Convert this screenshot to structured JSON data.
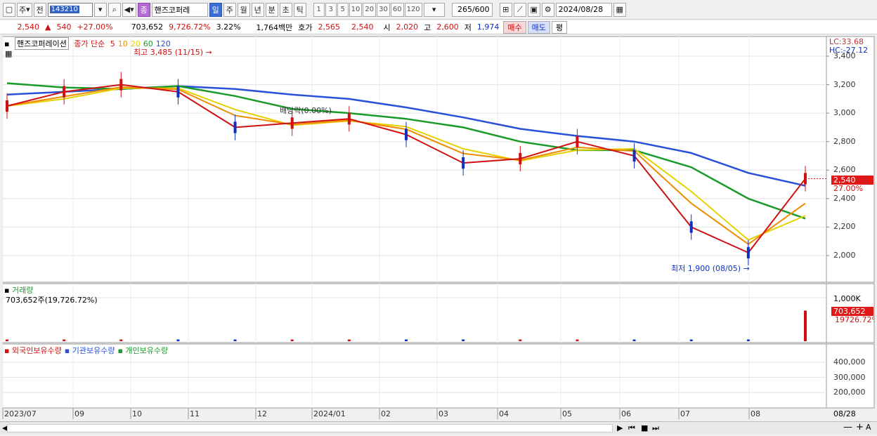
{
  "toolbar": {
    "mode_label": "주",
    "prev_label": "전",
    "stock_code": "143210",
    "stock_name": "핸즈코퍼레",
    "period_tabs": [
      "일",
      "주",
      "월",
      "년",
      "분",
      "초",
      "틱"
    ],
    "active_period": "일",
    "minute_options": [
      "1",
      "3",
      "5",
      "10",
      "20",
      "30",
      "60",
      "120"
    ],
    "count_display": "265/600",
    "date": "2024/08/28"
  },
  "price_row": {
    "price": "2,540",
    "change": "540",
    "change_pct": "+27.00%",
    "volume": "703,652",
    "volume_ratio": "9,726.72%",
    "turnover": "3.22%",
    "amount": "1,764백만",
    "quote_label": "호가",
    "ask": "2,565",
    "bid": "2,540",
    "open_label": "시",
    "open": "2,020",
    "high_label": "고",
    "high": "2,600",
    "low_label": "저",
    "low": "1,974",
    "buy_label": "매수",
    "sell_label": "매도",
    "eval_label": "평"
  },
  "price_panel": {
    "name": "핸즈코퍼레이션",
    "ma_label": "종가 단순",
    "ma_periods": [
      {
        "label": "5",
        "color": "#d01010"
      },
      {
        "label": "10",
        "color": "#f08c00"
      },
      {
        "label": "20",
        "color": "#e6d200"
      },
      {
        "label": "60",
        "color": "#1a9a2a"
      },
      {
        "label": "120",
        "color": "#2850d8"
      }
    ],
    "lc_label": "LC:33.68",
    "hc_label": "HC:-27.12",
    "high_annotation": "최고 3,485 (11/15)",
    "low_annotation": "최저 1,900 (08/05)",
    "dividend_annotation": "배당락(0.00%)",
    "current_price_tag": "2,540",
    "current_pct_tag": "27.00%",
    "y_ticks": [
      "3,400",
      "3,200",
      "3,000",
      "2,800",
      "2,600",
      "2,400",
      "2,200",
      "2,000"
    ]
  },
  "volume_panel": {
    "title": "거래량",
    "subtitle": "703,652주(19,726.72%)",
    "y_tick": "1,000K",
    "current_tag": "703,652",
    "current_pct_tag": "19726.72%"
  },
  "holding_panel": {
    "series": [
      {
        "label": "외국인보유수량",
        "color": "#d01010"
      },
      {
        "label": "기관보유수량",
        "color": "#2850d8"
      },
      {
        "label": "개인보유수량",
        "color": "#1a9a2a"
      }
    ],
    "y_ticks": [
      "400,000",
      "300,000",
      "200,000"
    ]
  },
  "x_axis": {
    "labels": [
      "2023/07",
      "09",
      "10",
      "11",
      "12",
      "2024/01",
      "02",
      "03",
      "04",
      "05",
      "06",
      "07",
      "08"
    ],
    "end_label": "08/28"
  },
  "colors": {
    "up": "#d01010",
    "down": "#1030c0"
  },
  "chart_data": {
    "type": "line",
    "x": [
      "2023/07",
      "2023/08",
      "2023/09",
      "2023/10",
      "2023/11",
      "2023/12",
      "2024/01",
      "2024/02",
      "2024/03",
      "2024/04",
      "2024/05",
      "2024/06",
      "2024/07",
      "2024/08",
      "2024/08/28"
    ],
    "series": [
      {
        "name": "종가",
        "values": [
          3050,
          3150,
          3200,
          3150,
          2900,
          2930,
          2960,
          2850,
          2650,
          2680,
          2800,
          2700,
          2200,
          2020,
          2540
        ]
      },
      {
        "name": "60",
        "values": [
          3210,
          3180,
          3170,
          3190,
          3120,
          3030,
          3000,
          2960,
          2900,
          2800,
          2740,
          2740,
          2620,
          2400,
          2260
        ]
      },
      {
        "name": "120",
        "values": [
          3130,
          3150,
          3170,
          3190,
          3170,
          3130,
          3100,
          3040,
          2970,
          2890,
          2840,
          2800,
          2720,
          2580,
          2490
        ]
      }
    ],
    "ylim": [
      1900,
      3485
    ]
  }
}
